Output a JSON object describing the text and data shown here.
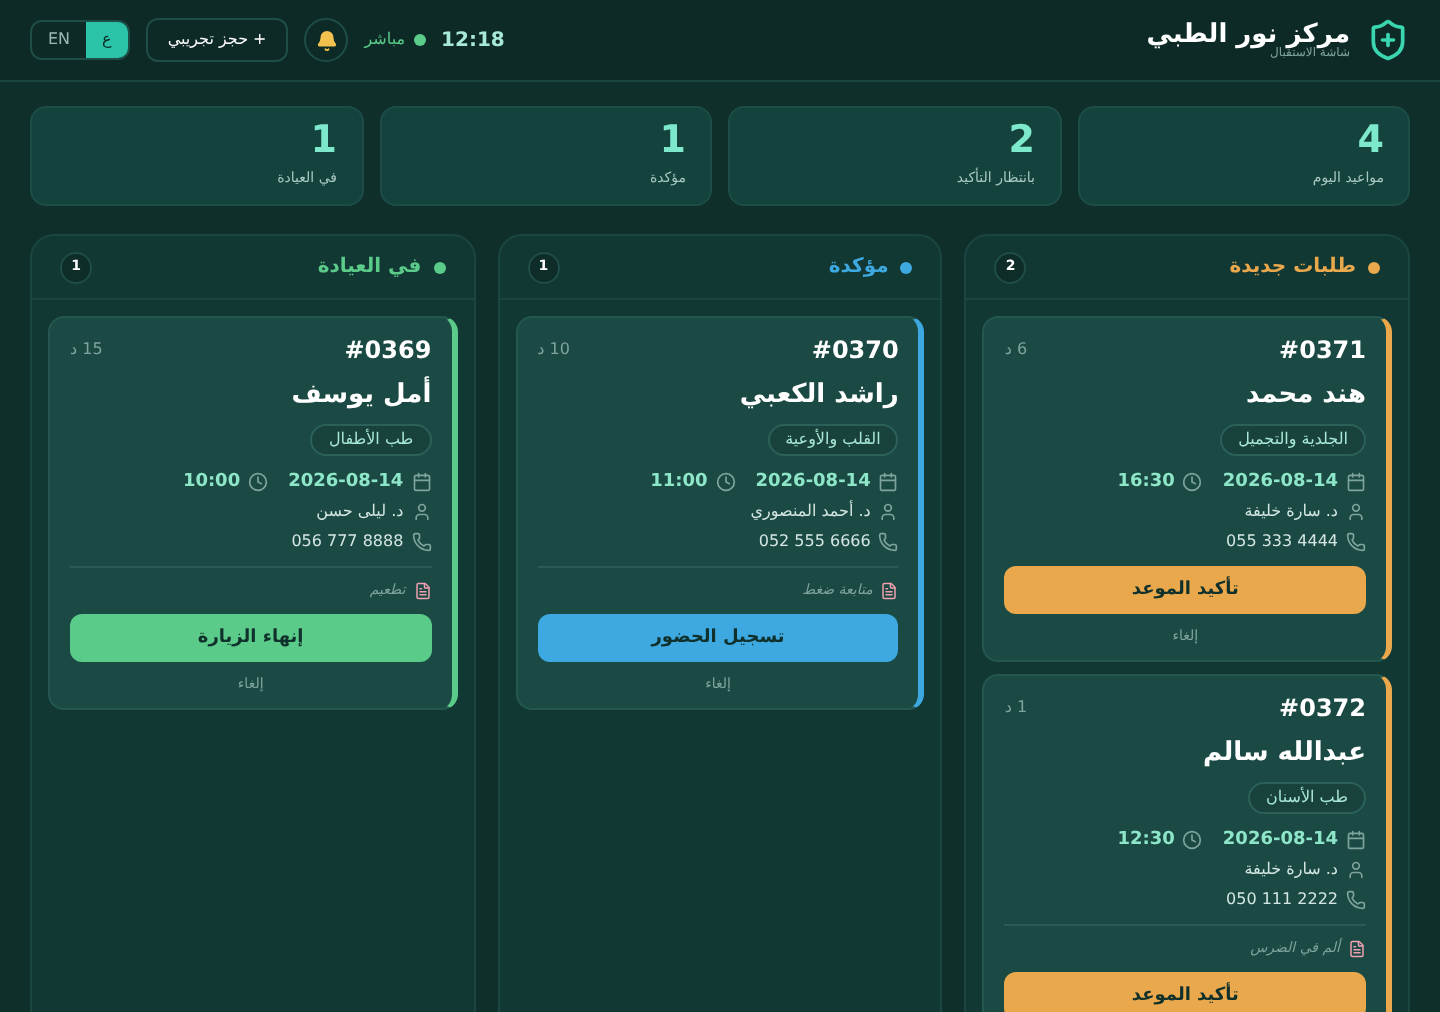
{
  "header": {
    "title": "مركز نور الطبي",
    "subtitle": "شاشة الاستقبال",
    "time": "12:18",
    "live_label": "مباشر",
    "demo_button": "+ حجز تجريبي",
    "languages": [
      {
        "label": "ع",
        "selected": true
      },
      {
        "label": "EN",
        "selected": false
      }
    ]
  },
  "stats": [
    {
      "value": "4",
      "label": "مواعيد اليوم"
    },
    {
      "value": "2",
      "label": "بانتظار التأكيد"
    },
    {
      "value": "1",
      "label": "مؤكدة"
    },
    {
      "value": "1",
      "label": "في العيادة"
    }
  ],
  "columns": [
    {
      "title": "طلبات جديدة",
      "count": "2",
      "color": "#e9a84c",
      "cards": [
        {
          "id": "#0371",
          "wait": "6 د",
          "name": "هند محمد",
          "department": "الجلدية والتجميل",
          "date": "2026-08-14",
          "time": "16:30",
          "doctor": "د. سارة خليفة",
          "phone": "055 333 4444",
          "action": "تأكيد الموعد",
          "cancel": "إلغاء"
        },
        {
          "id": "#0372",
          "wait": "1 د",
          "name": "عبدالله سالم",
          "department": "طب الأسنان",
          "date": "2026-08-14",
          "time": "12:30",
          "doctor": "د. سارة خليفة",
          "phone": "050 111 2222",
          "note": "ألم في الضرس",
          "action": "تأكيد الموعد"
        }
      ]
    },
    {
      "title": "مؤكدة",
      "count": "1",
      "color": "#3ea8e0",
      "cards": [
        {
          "id": "#0370",
          "wait": "10 د",
          "name": "راشد الكعبي",
          "department": "القلب والأوعية",
          "date": "2026-08-14",
          "time": "11:00",
          "doctor": "د. أحمد المنصوري",
          "phone": "052 555 6666",
          "note": "متابعة ضغط",
          "action": "تسجيل الحضور",
          "cancel": "إلغاء"
        }
      ]
    },
    {
      "title": "في العيادة",
      "count": "1",
      "color": "#5bcb8a",
      "cards": [
        {
          "id": "#0369",
          "wait": "15 د",
          "name": "أمل يوسف",
          "department": "طب الأطفال",
          "date": "2026-08-14",
          "time": "10:00",
          "doctor": "د. ليلى حسن",
          "phone": "056 777 8888",
          "note": "تطعيم",
          "action": "إنهاء الزيارة",
          "cancel": "إلغاء"
        }
      ]
    }
  ]
}
